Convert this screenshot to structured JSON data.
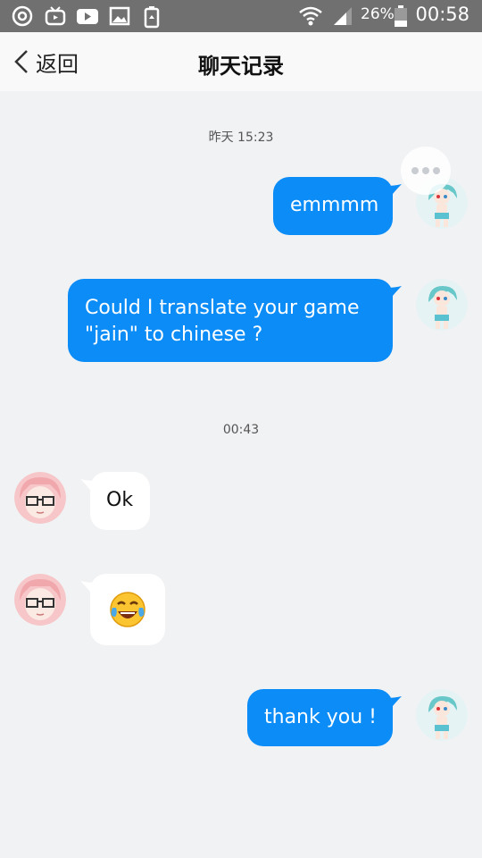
{
  "status_bar": {
    "battery": "26%",
    "time": "00:58"
  },
  "header": {
    "back_label": "返回",
    "title": "聊天记录"
  },
  "messages": {
    "ts1": "昨天 15:23",
    "m1": "emmmm",
    "m2_line1": "Could I translate your game",
    "m2_line2": "\"jain\" to chinese ?",
    "ts2": "00:43",
    "m3": "Ok",
    "m4_emoji": "😂",
    "m5": "thank you !"
  },
  "colors": {
    "outgoing_bubble": "#0c8cf6",
    "incoming_bubble": "#ffffff",
    "background": "#f1f2f4"
  }
}
